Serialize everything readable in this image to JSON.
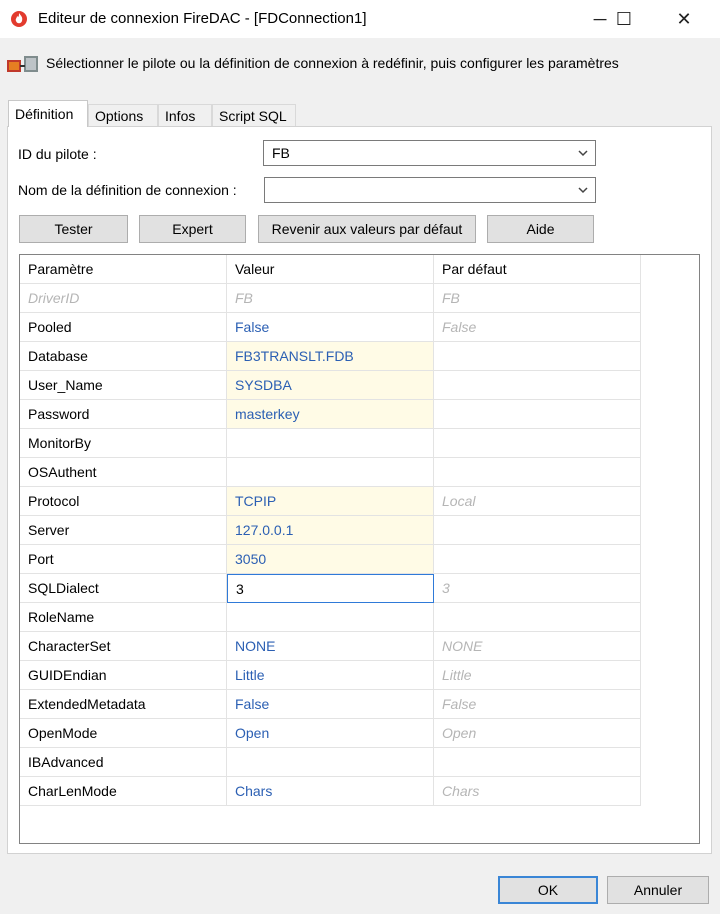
{
  "window": {
    "title": "Editeur de connexion FireDAC - [FDConnection1]",
    "minimize_glyph": "─",
    "maximize_glyph": "☐",
    "close_glyph": "✕"
  },
  "banner": {
    "text": "Sélectionner le pilote ou la définition de connexion à redéfinir, puis configurer les paramètres"
  },
  "tabs": [
    "Définition",
    "Options",
    "Infos",
    "Script SQL"
  ],
  "form": {
    "driver_label": "ID du pilote :",
    "driver_value": "FB",
    "connection_def_label": "Nom de la définition de connexion :",
    "connection_def_value": ""
  },
  "buttons": {
    "test": "Tester",
    "expert": "Expert",
    "reset_defaults": "Revenir aux valeurs par défaut",
    "help": "Aide",
    "ok": "OK",
    "cancel": "Annuler"
  },
  "grid": {
    "headers": [
      "Paramètre",
      "Valeur",
      "Par défaut"
    ],
    "rows": [
      {
        "param": "DriverID",
        "value": "FB",
        "default": "FB",
        "state": "readonly"
      },
      {
        "param": "Pooled",
        "value": "False",
        "default": "False",
        "state": "default"
      },
      {
        "param": "Database",
        "value": "FB3TRANSLT.FDB",
        "default": "",
        "state": "required"
      },
      {
        "param": "User_Name",
        "value": "SYSDBA",
        "default": "",
        "state": "required"
      },
      {
        "param": "Password",
        "value": "masterkey",
        "default": "",
        "state": "required"
      },
      {
        "param": "MonitorBy",
        "value": "",
        "default": "",
        "state": "default"
      },
      {
        "param": "OSAuthent",
        "value": "",
        "default": "",
        "state": "default"
      },
      {
        "param": "Protocol",
        "value": "TCPIP",
        "default": "Local",
        "state": "required"
      },
      {
        "param": "Server",
        "value": "127.0.0.1",
        "default": "",
        "state": "required"
      },
      {
        "param": "Port",
        "value": "3050",
        "default": "",
        "state": "required"
      },
      {
        "param": "SQLDialect",
        "value": "3",
        "default": "3",
        "state": "editing"
      },
      {
        "param": "RoleName",
        "value": "",
        "default": "",
        "state": "default"
      },
      {
        "param": "CharacterSet",
        "value": "NONE",
        "default": "NONE",
        "state": "default"
      },
      {
        "param": "GUIDEndian",
        "value": "Little",
        "default": "Little",
        "state": "default"
      },
      {
        "param": "ExtendedMetadata",
        "value": "False",
        "default": "False",
        "state": "default"
      },
      {
        "param": "OpenMode",
        "value": "Open",
        "default": "Open",
        "state": "default"
      },
      {
        "param": "IBAdvanced",
        "value": "",
        "default": "",
        "state": "default"
      },
      {
        "param": "CharLenMode",
        "value": "Chars",
        "default": "Chars",
        "state": "default"
      }
    ]
  },
  "colors": {
    "value_blue": "#2b5fb3",
    "highlight": "#fffbe6",
    "focus_border": "#2f7ad8"
  }
}
